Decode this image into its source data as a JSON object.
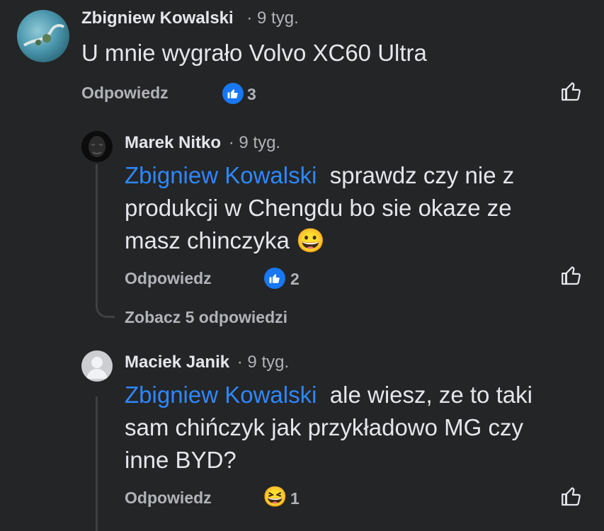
{
  "comments": [
    {
      "author": "Zbigniew Kowalski",
      "time": "· 9 tyg.",
      "text": "U mnie wygrało Volvo XC60 Ultra",
      "reply_label": "Odpowiedz",
      "reaction_icon": "like-icon",
      "reaction_count": "3"
    }
  ],
  "replies": [
    {
      "author": "Marek Nitko",
      "time": "· 9 tyg.",
      "mention": "Zbigniew Kowalski",
      "text_line1": "sprawdz czy nie z",
      "text_line2": "produkcji w  Chengdu bo sie okaze ze",
      "text_line3": "masz chinczyka",
      "emoji": "😀",
      "reply_label": "Odpowiedz",
      "reaction_icon": "like-icon",
      "reaction_count": "2",
      "more_replies": "Zobacz 5 odpowiedzi"
    },
    {
      "author": "Maciek Janik",
      "time": "· 9 tyg.",
      "mention": "Zbigniew Kowalski",
      "text_line1": "ale wiesz, ze to taki",
      "text_line2": "sam chińczyk jak przykładowo MG czy",
      "text_line3": "inne BYD?",
      "reply_label": "Odpowiedz",
      "reaction_icon": "haha-icon",
      "reaction_emoji": "😆",
      "reaction_count": "1"
    }
  ]
}
